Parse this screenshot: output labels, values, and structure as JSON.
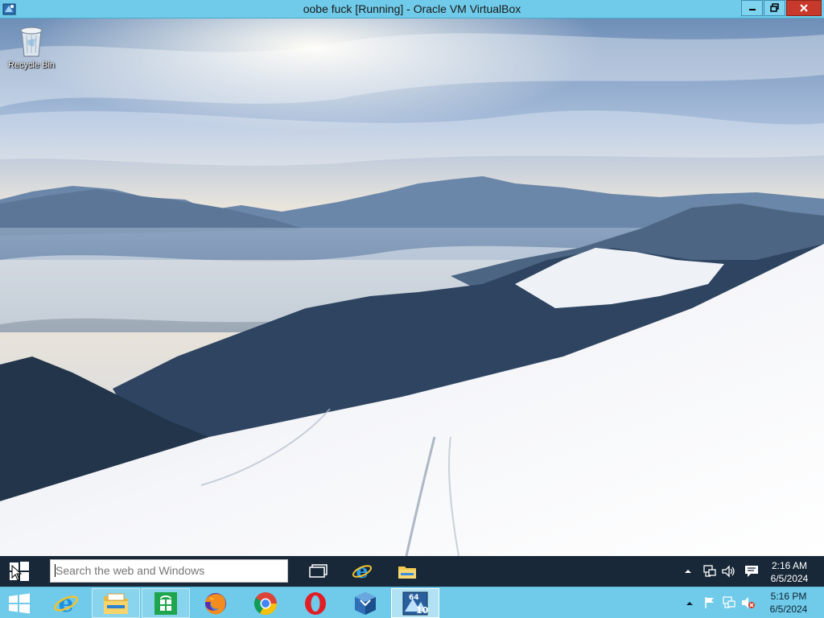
{
  "vbox_window": {
    "title": "oobe fuck [Running] - Oracle VM VirtualBox",
    "controls": {
      "minimize": "minimize-icon",
      "restore": "restore-icon",
      "close": "close-icon"
    }
  },
  "guest": {
    "desktop": {
      "icons": [
        {
          "label": "Recycle Bin",
          "icon": "recycle-bin-icon"
        }
      ]
    },
    "taskbar": {
      "start_icon": "windows-logo-icon",
      "search_placeholder": "Search the web and Windows",
      "pinned": [
        {
          "name": "task-view",
          "icon": "task-view-icon"
        },
        {
          "name": "internet-explorer",
          "icon": "internet-explorer-icon"
        },
        {
          "name": "file-explorer",
          "icon": "file-explorer-icon"
        }
      ],
      "tray": [
        "show-hidden-icons",
        "network-icon",
        "volume-icon",
        "action-center-icon"
      ],
      "time": "2:16 AM",
      "date": "6/5/2024"
    }
  },
  "host": {
    "taskbar": {
      "start_icon": "windows-logo-icon",
      "apps": [
        {
          "name": "internet-explorer",
          "icon": "internet-explorer-icon"
        },
        {
          "name": "file-explorer",
          "icon": "file-explorer-icon"
        },
        {
          "name": "store",
          "icon": "store-icon"
        },
        {
          "name": "firefox",
          "icon": "firefox-icon"
        },
        {
          "name": "chrome",
          "icon": "chrome-icon"
        },
        {
          "name": "opera",
          "icon": "opera-icon"
        },
        {
          "name": "virtualbox",
          "icon": "virtualbox-icon"
        },
        {
          "name": "virtualbox-vm",
          "icon": "vm-window-icon",
          "badge_top": "64",
          "badge_bottom": "10"
        }
      ],
      "tray": [
        "show-hidden-icons",
        "flag-icon",
        "network-icon",
        "volume-muted-icon"
      ],
      "time": "5:16 PM",
      "date": "6/5/2024"
    }
  },
  "colors": {
    "host_taskbar": "#6fcbe9",
    "guest_taskbar": "#182838",
    "close_button": "#c7392b"
  }
}
